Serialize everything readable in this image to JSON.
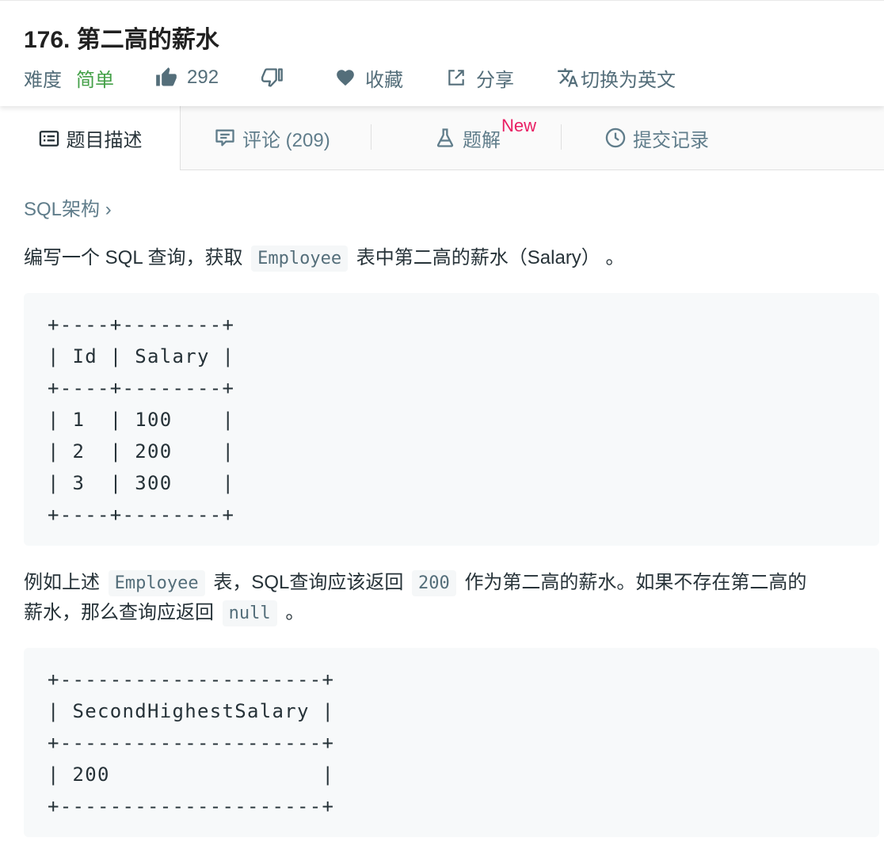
{
  "problem": {
    "title": "176. 第二高的薪水",
    "difficulty_label": "难度",
    "difficulty_value": "简单",
    "likes": "292",
    "favorite_label": "收藏",
    "share_label": "分享",
    "language_toggle_label": "切换为英文"
  },
  "tabs": {
    "description": "题目描述",
    "comments": "评论 (209)",
    "solutions": "题解",
    "solutions_badge": "New",
    "submissions": "提交记录"
  },
  "breadcrumb": "SQL架构 ›",
  "content": {
    "p1_before": "编写一个 SQL 查询，获取",
    "p1_code": "Employee",
    "p1_after": "表中第二高的薪水（Salary） 。",
    "table1": "+----+--------+\n| Id | Salary |\n+----+--------+\n| 1  | 100    |\n| 2  | 200    |\n| 3  | 300    |\n+----+--------+",
    "p2_before": "例如上述",
    "p2_code1": "Employee",
    "p2_mid": "表，SQL查询应该返回",
    "p2_code2": "200",
    "p2_after": "作为第二高的薪水。如果不存在第二高的",
    "p3_before": "薪水，那么查询应返回",
    "p3_code": "null",
    "p3_after": "。",
    "table2": "+---------------------+\n| SecondHighestSalary |\n+---------------------+\n| 200                 |\n+---------------------+"
  },
  "colors": {
    "difficulty_easy": "#43a047",
    "new_badge": "#e91e63",
    "muted_text": "#607d8b"
  }
}
